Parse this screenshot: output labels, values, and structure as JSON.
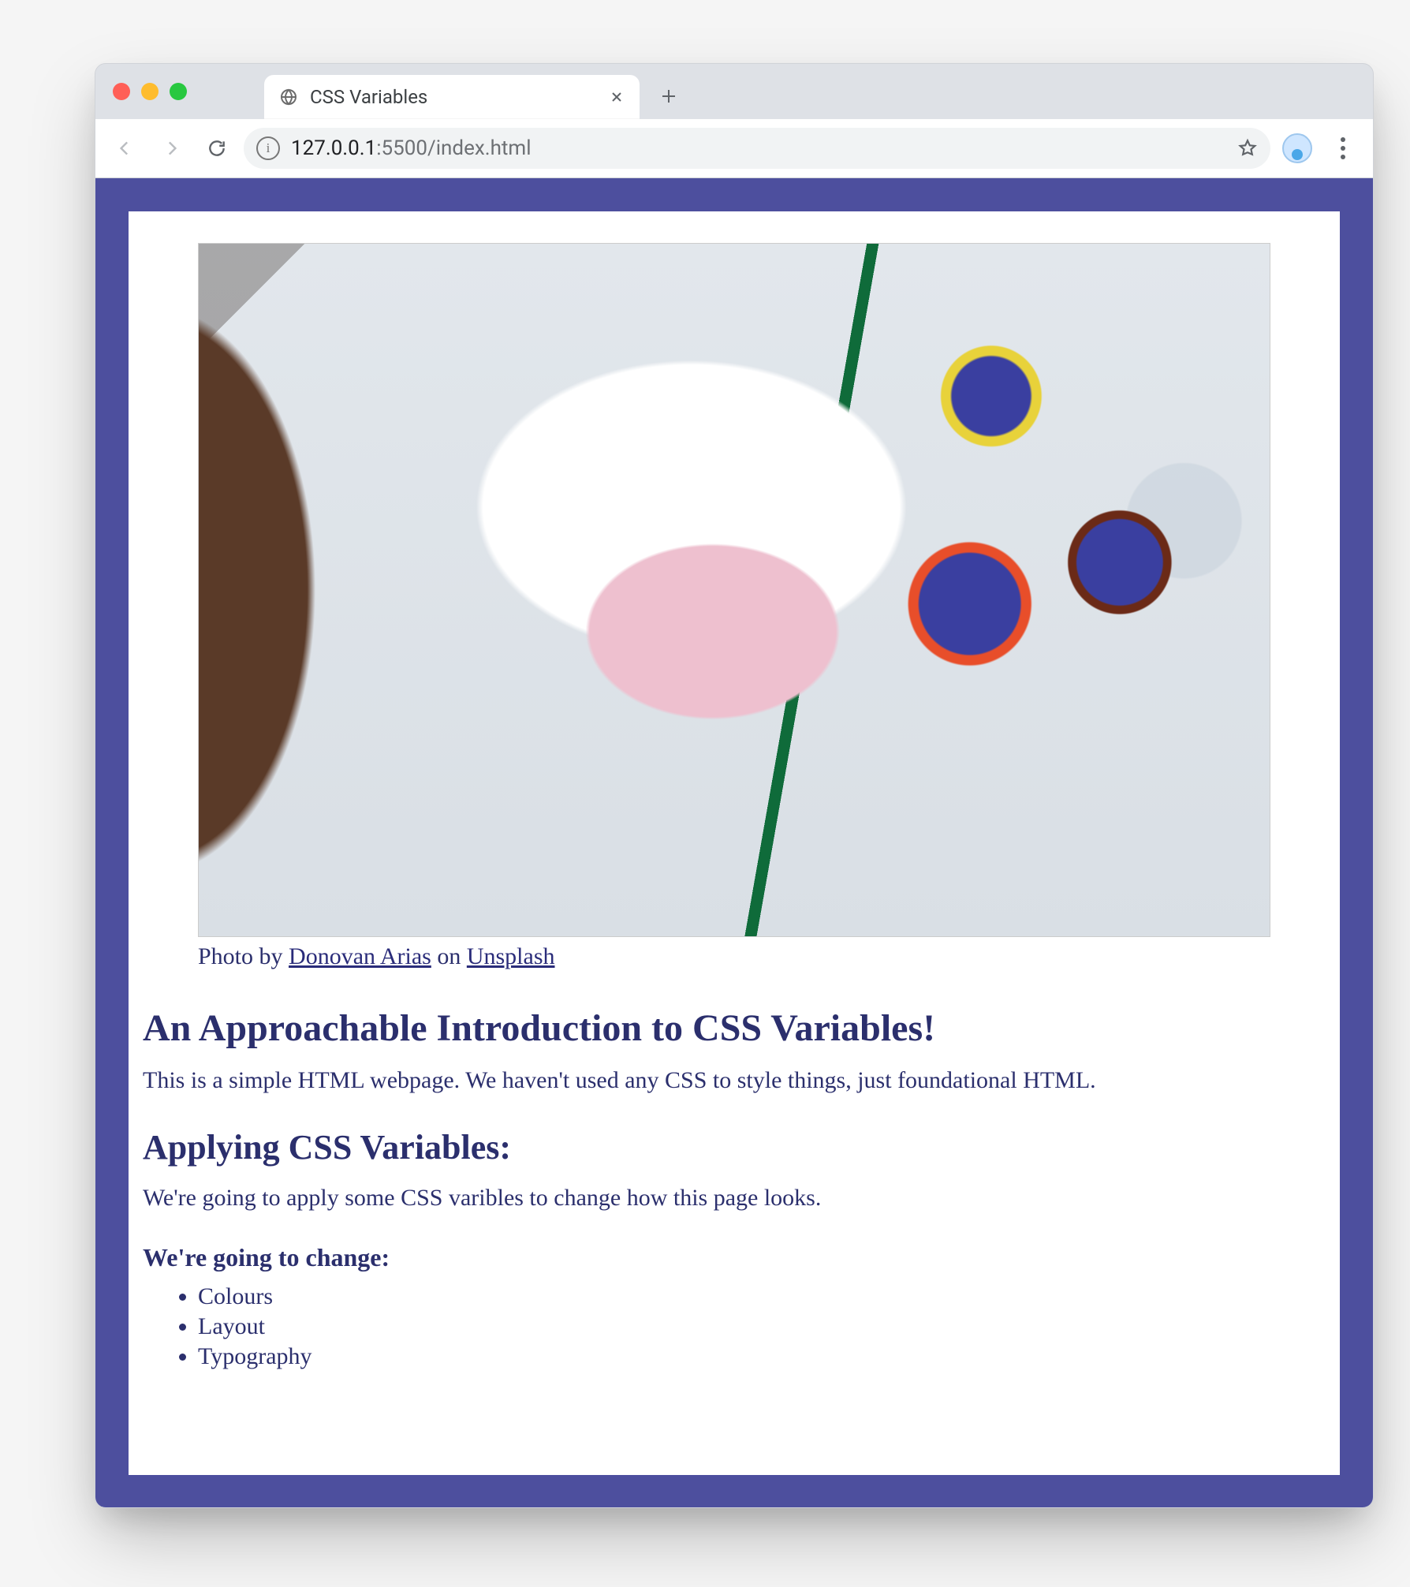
{
  "browser": {
    "tab_title": "CSS Variables",
    "url_host": "127.0.0.1",
    "url_path": ":5500/index.html"
  },
  "page": {
    "caption_prefix": "Photo by ",
    "caption_author": "Donovan Arias",
    "caption_middle": " on ",
    "caption_site": "Unsplash",
    "h1": "An Approachable Introduction to CSS Variables!",
    "p1": "This is a simple HTML webpage. We haven't used any CSS to style things, just foundational HTML.",
    "h2": "Applying CSS Variables:",
    "p2": "We're going to apply some CSS varibles to change how this page looks.",
    "h3": "We're going to change:",
    "list": [
      "Colours",
      "Layout",
      "Typography"
    ]
  }
}
